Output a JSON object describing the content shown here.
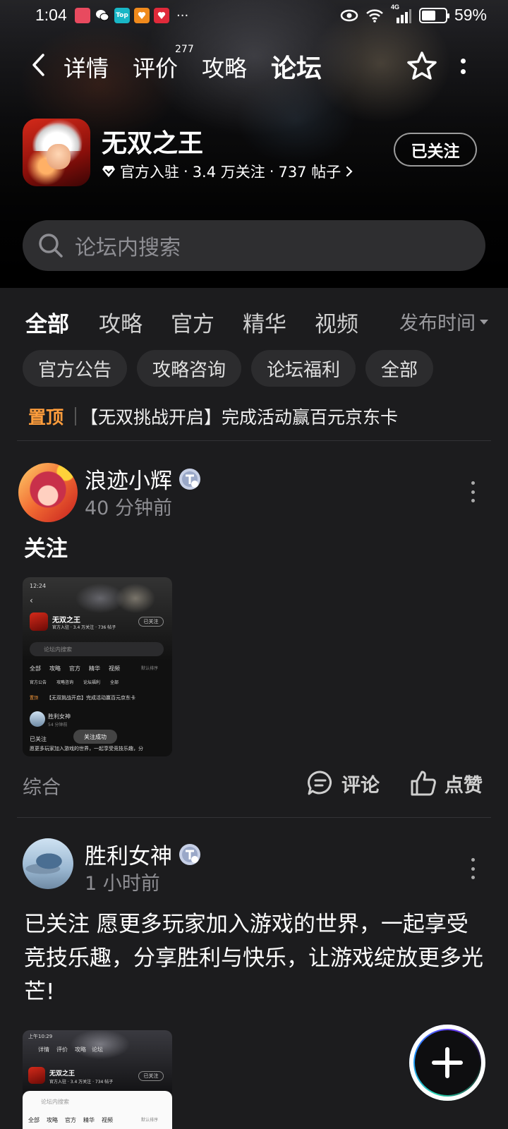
{
  "status_bar": {
    "time": "1:04",
    "apps": [
      {
        "name": "shopping-app",
        "label": "",
        "color": "#e84a5f"
      },
      {
        "name": "wechat",
        "label": "",
        "color": "#2b2b2b"
      },
      {
        "name": "top-app",
        "label": "Top",
        "color": "#19b7c6"
      },
      {
        "name": "orange-app",
        "label": "",
        "color": "#f08a1c"
      },
      {
        "name": "red-app",
        "label": "",
        "color": "#e02a3a"
      }
    ],
    "network": "4G",
    "battery": "59%",
    "battery_level": 0.59
  },
  "nav": {
    "tabs": [
      "详情",
      "评价",
      "攻略",
      "论坛"
    ],
    "active_tab": "论坛",
    "review_count": "277"
  },
  "game": {
    "title": "无双之王",
    "official": "官方入驻",
    "followers": "3.4 万关注",
    "posts": "737 帖子",
    "follow_label": "已关注"
  },
  "search": {
    "placeholder": "论坛内搜索"
  },
  "categories": {
    "tabs": [
      "全部",
      "攻略",
      "官方",
      "精华",
      "视频"
    ],
    "active": "全部",
    "sort_label": "发布时间"
  },
  "chips": [
    "官方公告",
    "攻略咨询",
    "论坛福利",
    "全部"
  ],
  "pinned": {
    "label": "置顶",
    "text": "【无双挑战开启】完成活动赢百元京东卡"
  },
  "posts": [
    {
      "username": "浪迹小辉",
      "time": "40 分钟前",
      "title": "关注",
      "category": "综合",
      "comment_label": "评论",
      "like_label": "点赞",
      "thumbnail": {
        "time": "12:24",
        "game_title": "无双之王",
        "meta": "官方入驻 · 3.4 万关注 · 736 帖子",
        "follow": "已关注",
        "search": "论坛内搜索",
        "tabs": [
          "全部",
          "攻略",
          "官方",
          "精华",
          "视频"
        ],
        "sort": "默认排序",
        "chips": [
          "官方公告",
          "攻略咨询",
          "论坛福利",
          "全部"
        ],
        "pin_label": "置顶",
        "pin_text": "【无双挑战开启】完成活动赢百元京东卡",
        "user": "胜利女神",
        "user_time": "54 分钟前",
        "post_title": "已关注",
        "post_text": "愿更多玩家加入游戏的世界，一起享受竞技乐趣，分",
        "toast": "关注成功"
      }
    },
    {
      "username": "胜利女神",
      "time": "1 小时前",
      "text": "已关注 愿更多玩家加入游戏的世界，一起享受竞技乐趣，分享胜利与快乐，让游戏绽放更多光芒!",
      "thumbnail": {
        "time": "上午10:29",
        "tabs": [
          "详情",
          "评价",
          "攻略",
          "论坛"
        ],
        "game_title": "无双之王",
        "meta": "官方入驻 · 3.4 万关注 · 734 帖子",
        "follow": "已关注",
        "search": "论坛内搜索",
        "cat_tabs": [
          "全部",
          "攻略",
          "官方",
          "精华",
          "视频"
        ],
        "sort": "默认排序"
      }
    }
  ],
  "colors": {
    "accent": "#19c3a6",
    "pinned": "#ff9d3c",
    "background": "#1c1c1e"
  }
}
